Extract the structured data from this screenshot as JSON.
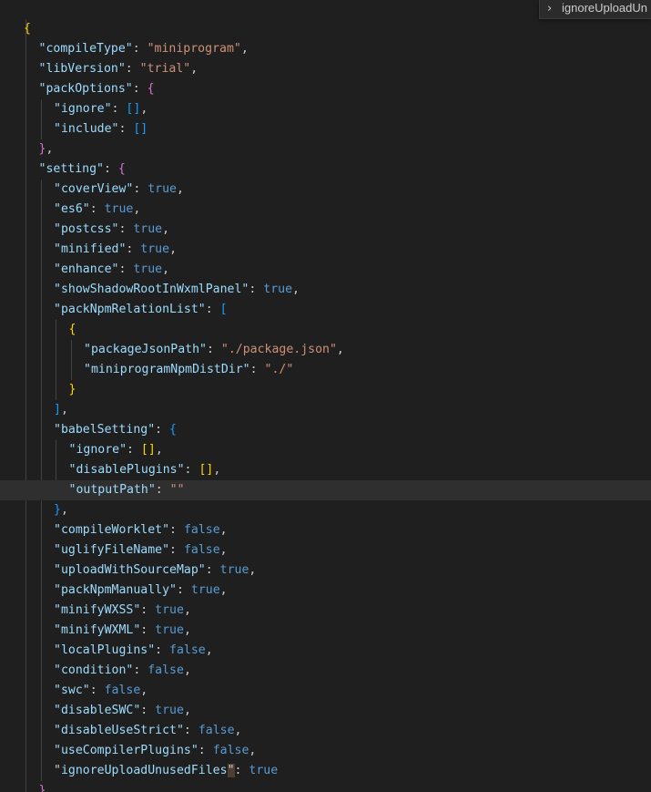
{
  "sticky_header": {
    "icon": "chevron-right-icon",
    "glyph": "›",
    "label": "ignoreUploadUn"
  },
  "colors": {
    "background": "#1f1f1f",
    "key": "#9cdcfe",
    "string": "#ce9178",
    "boolean": "#569cd6",
    "punctuation": "#cccccc",
    "bracket_level1": "#ffd700",
    "bracket_level2": "#da70d6",
    "bracket_level3": "#179fff"
  },
  "lines": [
    [
      [
        "y",
        "{"
      ]
    ],
    [
      [
        "k",
        "\"compileType\""
      ],
      [
        "p",
        ": "
      ],
      [
        "s",
        "\"miniprogram\""
      ],
      [
        "p",
        ","
      ]
    ],
    [
      [
        "k",
        "\"libVersion\""
      ],
      [
        "p",
        ": "
      ],
      [
        "s",
        "\"trial\""
      ],
      [
        "p",
        ","
      ]
    ],
    [
      [
        "k",
        "\"packOptions\""
      ],
      [
        "p",
        ": "
      ],
      [
        "m",
        "{"
      ]
    ],
    [
      [
        "k",
        "\"ignore\""
      ],
      [
        "p",
        ": "
      ],
      [
        "c",
        "[]"
      ],
      [
        "p",
        ","
      ]
    ],
    [
      [
        "k",
        "\"include\""
      ],
      [
        "p",
        ": "
      ],
      [
        "c",
        "[]"
      ]
    ],
    [
      [
        "m",
        "}"
      ],
      [
        "p",
        ","
      ]
    ],
    [
      [
        "k",
        "\"setting\""
      ],
      [
        "p",
        ": "
      ],
      [
        "m",
        "{"
      ]
    ],
    [
      [
        "k",
        "\"coverView\""
      ],
      [
        "p",
        ": "
      ],
      [
        "b",
        "true"
      ],
      [
        "p",
        ","
      ]
    ],
    [
      [
        "k",
        "\"es6\""
      ],
      [
        "p",
        ": "
      ],
      [
        "b",
        "true"
      ],
      [
        "p",
        ","
      ]
    ],
    [
      [
        "k",
        "\"postcss\""
      ],
      [
        "p",
        ": "
      ],
      [
        "b",
        "true"
      ],
      [
        "p",
        ","
      ]
    ],
    [
      [
        "k",
        "\"minified\""
      ],
      [
        "p",
        ": "
      ],
      [
        "b",
        "true"
      ],
      [
        "p",
        ","
      ]
    ],
    [
      [
        "k",
        "\"enhance\""
      ],
      [
        "p",
        ": "
      ],
      [
        "b",
        "true"
      ],
      [
        "p",
        ","
      ]
    ],
    [
      [
        "k",
        "\"showShadowRootInWxmlPanel\""
      ],
      [
        "p",
        ": "
      ],
      [
        "b",
        "true"
      ],
      [
        "p",
        ","
      ]
    ],
    [
      [
        "k",
        "\"packNpmRelationList\""
      ],
      [
        "p",
        ": "
      ],
      [
        "c",
        "["
      ]
    ],
    [
      [
        "y",
        "{"
      ]
    ],
    [
      [
        "k",
        "\"packageJsonPath\""
      ],
      [
        "p",
        ": "
      ],
      [
        "s",
        "\"./package.json\""
      ],
      [
        "p",
        ","
      ]
    ],
    [
      [
        "k",
        "\"miniprogramNpmDistDir\""
      ],
      [
        "p",
        ": "
      ],
      [
        "s",
        "\"./\""
      ]
    ],
    [
      [
        "y",
        "}"
      ]
    ],
    [
      [
        "c",
        "]"
      ],
      [
        "p",
        ","
      ]
    ],
    [
      [
        "k",
        "\"babelSetting\""
      ],
      [
        "p",
        ": "
      ],
      [
        "c",
        "{"
      ]
    ],
    [
      [
        "k",
        "\"ignore\""
      ],
      [
        "p",
        ": "
      ],
      [
        "y",
        "[]"
      ],
      [
        "p",
        ","
      ]
    ],
    [
      [
        "k",
        "\"disablePlugins\""
      ],
      [
        "p",
        ": "
      ],
      [
        "y",
        "[]"
      ],
      [
        "p",
        ","
      ]
    ],
    [
      [
        "k",
        "\"outputPath\""
      ],
      [
        "p",
        ": "
      ],
      [
        "s",
        "\"\""
      ]
    ],
    [
      [
        "c",
        "}"
      ],
      [
        "p",
        ","
      ]
    ],
    [
      [
        "k",
        "\"compileWorklet\""
      ],
      [
        "p",
        ": "
      ],
      [
        "b",
        "false"
      ],
      [
        "p",
        ","
      ]
    ],
    [
      [
        "k",
        "\"uglifyFileName\""
      ],
      [
        "p",
        ": "
      ],
      [
        "b",
        "false"
      ],
      [
        "p",
        ","
      ]
    ],
    [
      [
        "k",
        "\"uploadWithSourceMap\""
      ],
      [
        "p",
        ": "
      ],
      [
        "b",
        "true"
      ],
      [
        "p",
        ","
      ]
    ],
    [
      [
        "k",
        "\"packNpmManually\""
      ],
      [
        "p",
        ": "
      ],
      [
        "b",
        "true"
      ],
      [
        "p",
        ","
      ]
    ],
    [
      [
        "k",
        "\"minifyWXSS\""
      ],
      [
        "p",
        ": "
      ],
      [
        "b",
        "true"
      ],
      [
        "p",
        ","
      ]
    ],
    [
      [
        "k",
        "\"minifyWXML\""
      ],
      [
        "p",
        ": "
      ],
      [
        "b",
        "true"
      ],
      [
        "p",
        ","
      ]
    ],
    [
      [
        "k",
        "\"localPlugins\""
      ],
      [
        "p",
        ": "
      ],
      [
        "b",
        "false"
      ],
      [
        "p",
        ","
      ]
    ],
    [
      [
        "k",
        "\"condition\""
      ],
      [
        "p",
        ": "
      ],
      [
        "b",
        "false"
      ],
      [
        "p",
        ","
      ]
    ],
    [
      [
        "k",
        "\"swc\""
      ],
      [
        "p",
        ": "
      ],
      [
        "b",
        "false"
      ],
      [
        "p",
        ","
      ]
    ],
    [
      [
        "k",
        "\"disableSWC\""
      ],
      [
        "p",
        ": "
      ],
      [
        "b",
        "true"
      ],
      [
        "p",
        ","
      ]
    ],
    [
      [
        "k",
        "\"disableUseStrict\""
      ],
      [
        "p",
        ": "
      ],
      [
        "b",
        "false"
      ],
      [
        "p",
        ","
      ]
    ],
    [
      [
        "k",
        "\"useCompilerPlugins\""
      ],
      [
        "p",
        ": "
      ],
      [
        "b",
        "false"
      ],
      [
        "p",
        ","
      ]
    ],
    [
      [
        "p",
        "\""
      ],
      [
        "k",
        "ignoreUploadUnusedFiles"
      ],
      [
        "p",
        "\""
      ],
      [
        "p",
        ": "
      ],
      [
        "b",
        "true"
      ]
    ],
    [
      [
        "m",
        "},"
      ]
    ]
  ]
}
